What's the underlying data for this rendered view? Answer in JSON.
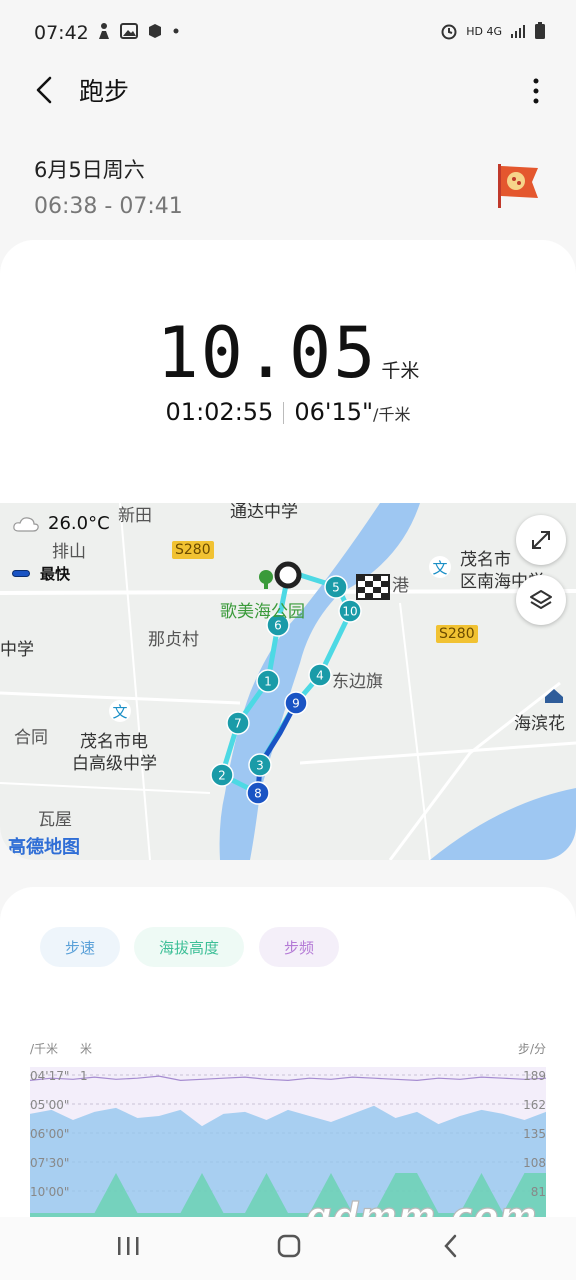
{
  "status_bar": {
    "time": "07:42",
    "network": "HD 4G"
  },
  "app_bar": {
    "title": "跑步"
  },
  "workout": {
    "date": "6月5日周六",
    "time_range": "06:38 - 07:41",
    "distance": "10.05",
    "distance_unit": "千米",
    "duration": "01:02:55",
    "pace": "06'15\"",
    "pace_unit": "/千米"
  },
  "map": {
    "weather": "26.0°C",
    "legend_fastest": "最快",
    "attribution": "高德地图",
    "labels": {
      "xintian": "新田",
      "paishan": "排山",
      "tongda": "通达中学",
      "gemei_park": "歌美海公园",
      "nazhen": "那贞村",
      "zhongxue_left": "中学",
      "hetong": "合同",
      "school_line1": "茂名市电",
      "school_line2": "白高级中学",
      "dongbianqi": "东边旗",
      "maoming_nanhai_line1": "茂名市",
      "maoming_nanhai_line2": "区南海中学",
      "haibin": "海滨花",
      "wawu": "瓦屋",
      "gang": "港"
    },
    "road_signs": [
      "S280",
      "S280"
    ],
    "markers": [
      "1",
      "2",
      "3",
      "4",
      "5",
      "6",
      "7",
      "8",
      "9",
      "10"
    ]
  },
  "chart_tabs": [
    "步速",
    "海拔高度",
    "步频"
  ],
  "chart_data": {
    "type": "area",
    "xlabel": "",
    "left_axis_units": [
      "/千米",
      "米"
    ],
    "right_axis_unit": "步/分",
    "pace_ticks": [
      "04'17\"",
      "05'00\"",
      "06'00\"",
      "07'30\"",
      "10'00\""
    ],
    "altitude_ticks": [
      "1"
    ],
    "cadence_ticks": [
      189,
      162,
      135,
      108,
      81
    ],
    "series": [
      {
        "name": "步速",
        "color": "#8fc4ee",
        "values": [
          6.2,
          6.0,
          6.5,
          6.1,
          5.9,
          6.4,
          6.3,
          6.0,
          6.8,
          6.2,
          6.1,
          6.5,
          6.0,
          6.3,
          6.6,
          6.2,
          5.8,
          6.4,
          6.1,
          6.7,
          6.3,
          6.0,
          6.2,
          6.5,
          6.1
        ]
      },
      {
        "name": "步频",
        "color": "#d4c3ef",
        "values": [
          184,
          186,
          185,
          187,
          185,
          186,
          188,
          184,
          185,
          186,
          187,
          185,
          184,
          186,
          185,
          187,
          186,
          185,
          184,
          186,
          185,
          187,
          186,
          185,
          186
        ]
      },
      {
        "name": "海拔高度",
        "color": "#5fd3a6",
        "values": [
          0,
          0,
          0,
          0,
          1,
          0,
          0,
          0,
          1,
          0,
          0,
          1,
          0,
          0,
          1,
          0,
          0,
          1,
          1,
          0,
          0,
          1,
          0,
          1,
          1
        ]
      }
    ]
  },
  "watermark": "gdmm.com"
}
